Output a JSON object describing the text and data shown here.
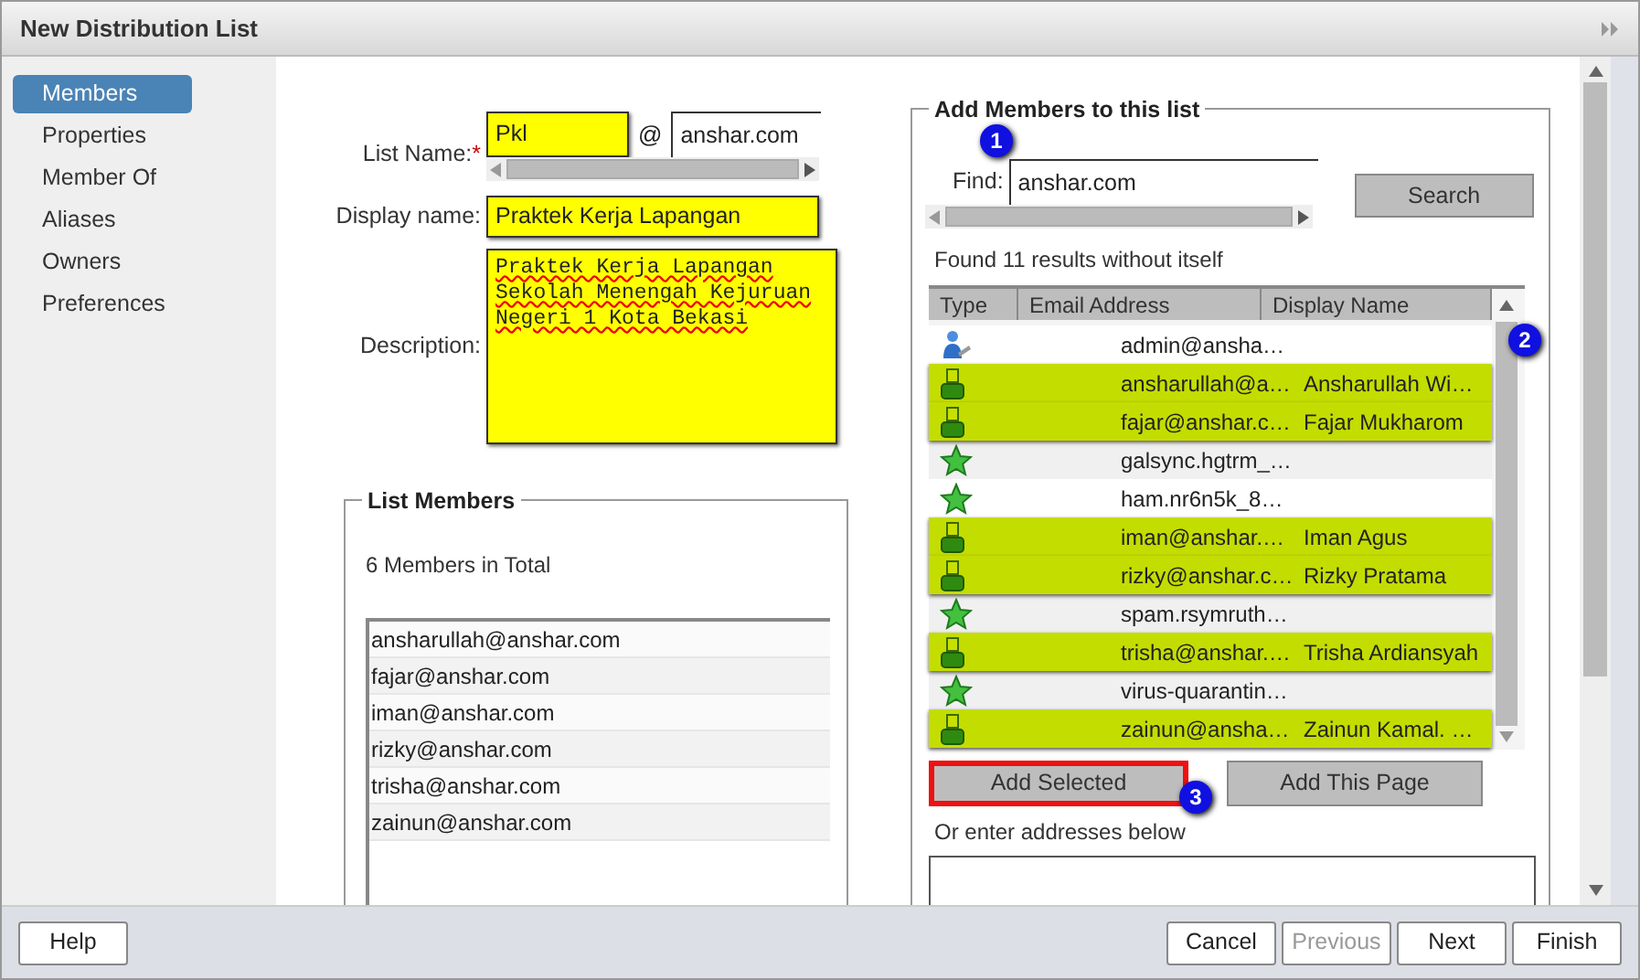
{
  "window": {
    "title": "New Distribution List"
  },
  "sidebar": {
    "items": [
      {
        "label": "Members",
        "selected": true
      },
      {
        "label": "Properties",
        "selected": false
      },
      {
        "label": "Member Of",
        "selected": false
      },
      {
        "label": "Aliases",
        "selected": false
      },
      {
        "label": "Owners",
        "selected": false
      },
      {
        "label": "Preferences",
        "selected": false
      }
    ]
  },
  "form": {
    "list_name_label": "List Name:",
    "required_mark": "*",
    "list_name": "Pkl",
    "at": "@",
    "domain": "anshar.com",
    "display_name_label": "Display name:",
    "display_name": "Praktek Kerja Lapangan",
    "description_label": "Description:",
    "description": "Praktek Kerja Lapangan\nSekolah Menengah Kejuruan\nNegeri 1 Kota Bekasi"
  },
  "list_members": {
    "title": "List Members",
    "count": "6 Members in Total",
    "items": [
      "ansharullah@anshar.com",
      "fajar@anshar.com",
      "iman@anshar.com",
      "rizky@anshar.com",
      "trisha@anshar.com",
      "zainun@anshar.com"
    ]
  },
  "add_members": {
    "title": "Add Members to this list",
    "find_label": "Find:",
    "find_value": "anshar.com",
    "search_button": "Search",
    "found_text": "Found 11 results without itself",
    "columns": [
      "Type",
      "Email Address",
      "Display Name"
    ],
    "rows": [
      {
        "kind": "admin",
        "email": "admin@ansha…",
        "selected": false
      },
      {
        "kind": "user",
        "email": "ansharullah@a…",
        "display_name": "Ansharullah Wi…",
        "selected": true
      },
      {
        "kind": "user",
        "email": "fajar@anshar.c…",
        "display_name": "Fajar Mukharom",
        "selected": true
      },
      {
        "kind": "resource",
        "email": "galsync.hgtrm_…",
        "selected": false
      },
      {
        "kind": "resource",
        "email": "ham.nr6n5k_8…",
        "selected": false
      },
      {
        "kind": "user",
        "email": "iman@anshar.…",
        "display_name": "Iman Agus",
        "selected": true
      },
      {
        "kind": "user",
        "email": "rizky@anshar.c…",
        "display_name": "Rizky Pratama",
        "selected": true
      },
      {
        "kind": "resource",
        "email": "spam.rsymruth…",
        "selected": false
      },
      {
        "kind": "user",
        "email": "trisha@anshar.…",
        "display_name": "Trisha Ardiansyah",
        "selected": true
      },
      {
        "kind": "resource",
        "email": "virus-quarantin…",
        "selected": false
      },
      {
        "kind": "user",
        "email": "zainun@ansha…",
        "display_name": "Zainun Kamal. …",
        "selected": true
      }
    ],
    "add_selected_button": "Add Selected",
    "add_page_button": "Add This Page",
    "addresses_label": "Or enter addresses below"
  },
  "callouts": [
    "1",
    "2",
    "3"
  ],
  "footer": {
    "help": "Help",
    "buttons": [
      {
        "label": "Cancel",
        "disabled": false
      },
      {
        "label": "Previous",
        "disabled": true
      },
      {
        "label": "Next",
        "disabled": false
      },
      {
        "label": "Finish",
        "disabled": false
      }
    ]
  }
}
